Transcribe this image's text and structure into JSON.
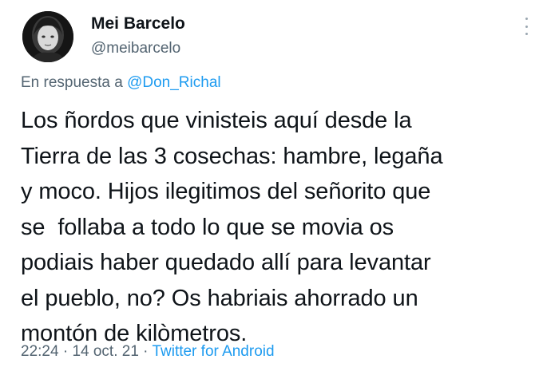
{
  "author": {
    "display_name": "Mei Barcelo",
    "handle": "@meibarcelo",
    "avatar_icon": "profile-photo"
  },
  "reply": {
    "prefix": "En respuesta a",
    "to_handle": "@Don_Richal"
  },
  "tweet": {
    "lines": [
      "Los ñordos que vinisteis aquí desde la",
      "Tierra de las 3 cosechas: hambre, legaña",
      "y moco. Hijos ilegitimos del señorito que",
      "se  follaba a todo lo que se movia os",
      "podiais haber quedado allí para levantar",
      "el pueblo, no? Os habriais ahorrado un",
      "montón de kilòmetros."
    ]
  },
  "meta": {
    "time": "22:24",
    "separator": "·",
    "date": "14 oct. 21",
    "source": "Twitter for Android"
  },
  "menu": {
    "icon": "more-vertical-icon"
  },
  "colors": {
    "text": "#0f1419",
    "secondary": "#536471",
    "link": "#1d9bf0"
  }
}
